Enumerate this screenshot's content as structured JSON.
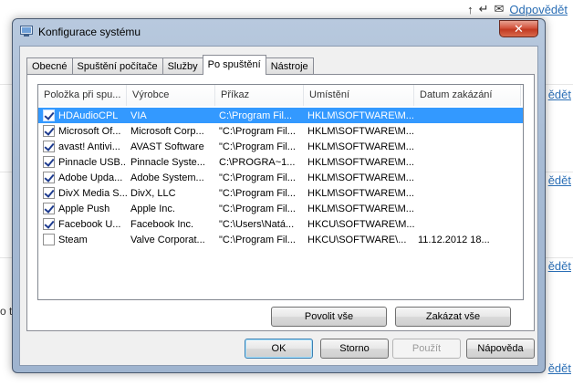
{
  "background": {
    "reply_label": "Odpovědět",
    "side_link_label": "ědět",
    "side_text": "o t"
  },
  "window": {
    "title": "Konfigurace systému",
    "close_glyph": "✕"
  },
  "tabs": [
    {
      "label": "Obecné"
    },
    {
      "label": "Spuštění počítače"
    },
    {
      "label": "Služby"
    },
    {
      "label": "Po spuštění"
    },
    {
      "label": "Nástroje"
    }
  ],
  "columns": [
    {
      "label": "Položka při spu..."
    },
    {
      "label": "Výrobce"
    },
    {
      "label": "Příkaz"
    },
    {
      "label": "Umístění"
    },
    {
      "label": "Datum zakázání"
    }
  ],
  "rows": [
    {
      "checked": true,
      "item": "HDAudioCPL",
      "maker": "VIA",
      "command": "C:\\Program Fil...",
      "location": "HKLM\\SOFTWARE\\M...",
      "date": ""
    },
    {
      "checked": true,
      "item": "Microsoft Of...",
      "maker": "Microsoft Corp...",
      "command": "\"C:\\Program Fil...",
      "location": "HKLM\\SOFTWARE\\M...",
      "date": ""
    },
    {
      "checked": true,
      "item": "avast! Antivi...",
      "maker": "AVAST Software",
      "command": "\"C:\\Program Fil...",
      "location": "HKLM\\SOFTWARE\\M...",
      "date": ""
    },
    {
      "checked": true,
      "item": "Pinnacle USB...",
      "maker": "Pinnacle Syste...",
      "command": "C:\\PROGRA~1...",
      "location": "HKLM\\SOFTWARE\\M...",
      "date": ""
    },
    {
      "checked": true,
      "item": "Adobe Upda...",
      "maker": "Adobe System...",
      "command": "\"C:\\Program Fil...",
      "location": "HKLM\\SOFTWARE\\M...",
      "date": ""
    },
    {
      "checked": true,
      "item": "DivX Media S...",
      "maker": "DivX, LLC",
      "command": "\"C:\\Program Fil...",
      "location": "HKLM\\SOFTWARE\\M...",
      "date": ""
    },
    {
      "checked": true,
      "item": "Apple Push",
      "maker": "Apple Inc.",
      "command": "\"C:\\Program Fil...",
      "location": "HKLM\\SOFTWARE\\M...",
      "date": ""
    },
    {
      "checked": true,
      "item": "Facebook U...",
      "maker": "Facebook Inc.",
      "command": "\"C:\\Users\\Natá...",
      "location": "HKCU\\SOFTWARE\\M...",
      "date": ""
    },
    {
      "checked": false,
      "item": "Steam",
      "maker": "Valve Corporat...",
      "command": "\"C:\\Program Fil...",
      "location": "HKCU\\SOFTWARE\\...",
      "date": "11.12.2012 18..."
    }
  ],
  "buttons": {
    "enable_all": "Povolit vše",
    "disable_all": "Zakázat vše",
    "ok": "OK",
    "cancel": "Storno",
    "apply": "Použít",
    "help": "Nápověda"
  }
}
